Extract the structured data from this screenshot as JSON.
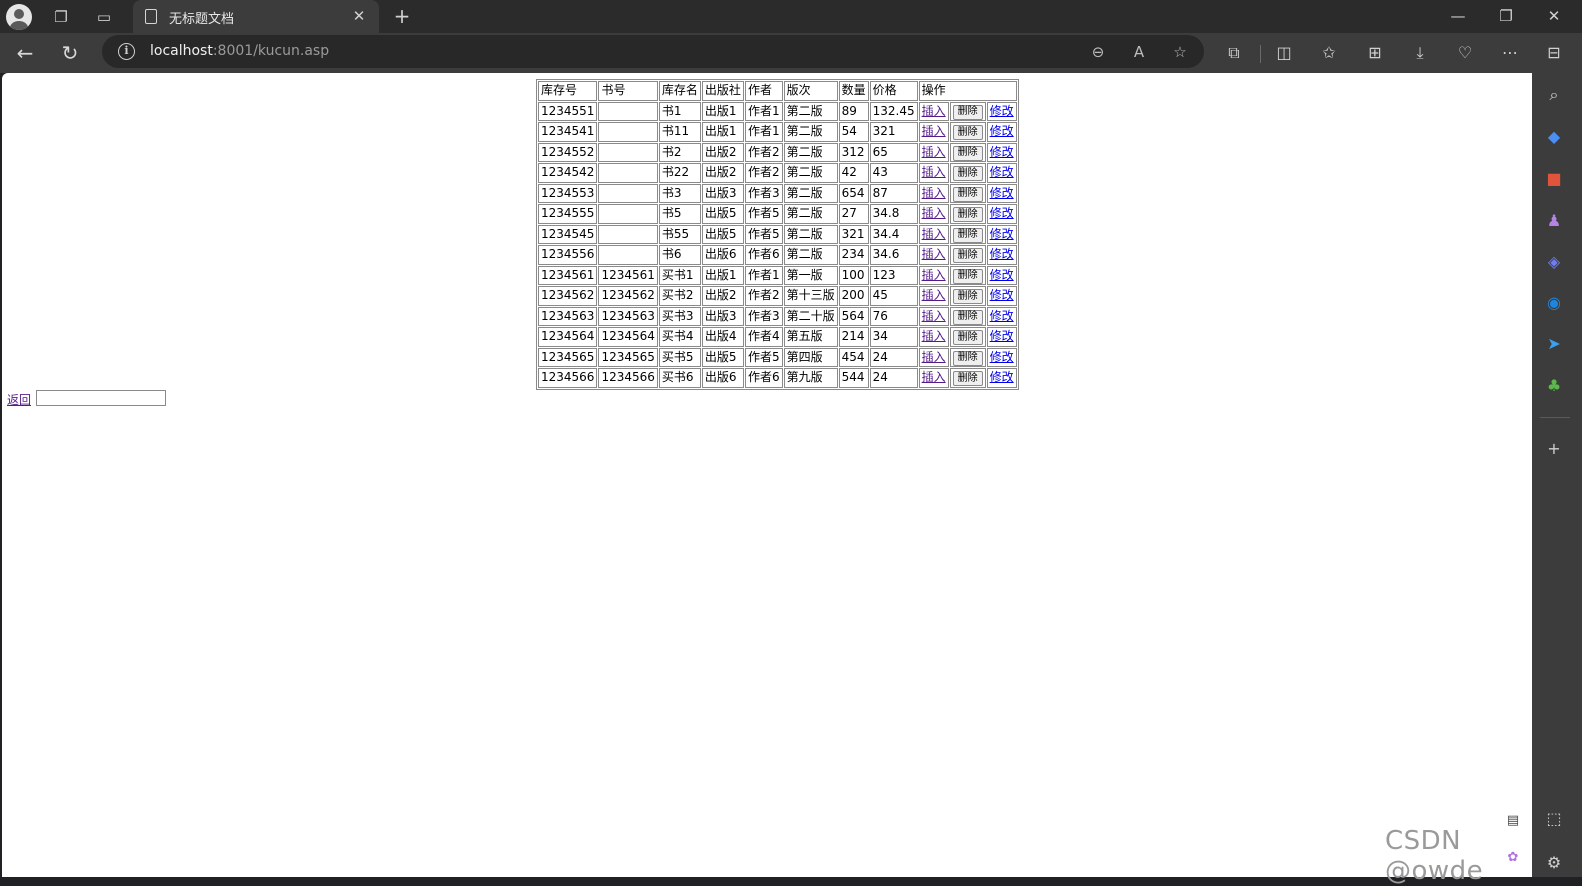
{
  "browser": {
    "tab_title": "无标题文档",
    "url_host": "localhost",
    "url_rest": ":8001/kucun.asp"
  },
  "table": {
    "headers": [
      "库存号",
      "书号",
      "库存名",
      "出版社",
      "作者",
      "版次",
      "数量",
      "价格",
      "操作"
    ],
    "rows": [
      [
        "1234551",
        "",
        "书1",
        "出版1",
        "作者1",
        "第二版",
        "89",
        "132.45"
      ],
      [
        "1234541",
        "",
        "书11",
        "出版1",
        "作者1",
        "第二版",
        "54",
        "321"
      ],
      [
        "1234552",
        "",
        "书2",
        "出版2",
        "作者2",
        "第二版",
        "312",
        "65"
      ],
      [
        "1234542",
        "",
        "书22",
        "出版2",
        "作者2",
        "第二版",
        "42",
        "43"
      ],
      [
        "1234553",
        "",
        "书3",
        "出版3",
        "作者3",
        "第二版",
        "654",
        "87"
      ],
      [
        "1234555",
        "",
        "书5",
        "出版5",
        "作者5",
        "第二版",
        "27",
        "34.8"
      ],
      [
        "1234545",
        "",
        "书55",
        "出版5",
        "作者5",
        "第二版",
        "321",
        "34.4"
      ],
      [
        "1234556",
        "",
        "书6",
        "出版6",
        "作者6",
        "第二版",
        "234",
        "34.6"
      ],
      [
        "1234561",
        "1234561",
        "买书1",
        "出版1",
        "作者1",
        "第一版",
        "100",
        "123"
      ],
      [
        "1234562",
        "1234562",
        "买书2",
        "出版2",
        "作者2",
        "第十三版",
        "200",
        "45"
      ],
      [
        "1234563",
        "1234563",
        "买书3",
        "出版3",
        "作者3",
        "第二十版",
        "564",
        "76"
      ],
      [
        "1234564",
        "1234564",
        "买书4",
        "出版4",
        "作者4",
        "第五版",
        "214",
        "34"
      ],
      [
        "1234565",
        "1234565",
        "买书5",
        "出版5",
        "作者5",
        "第四版",
        "454",
        "24"
      ],
      [
        "1234566",
        "1234566",
        "买书6",
        "出版6",
        "作者6",
        "第九版",
        "544",
        "24"
      ]
    ],
    "insert_label": "插入",
    "delete_label": "删除",
    "edit_label": "修改"
  },
  "footer": {
    "back_label": "返回",
    "input_value": ""
  },
  "watermark": "CSDN @owde",
  "icons": {
    "titlebar": [
      "profile-avatar-icon",
      "workspaces-icon",
      "tab-actions-icon"
    ],
    "toolbar": [
      "back-arrow-icon",
      "refresh-icon",
      "info-icon",
      "zoom-icon",
      "read-aloud-icon",
      "favorite-star-icon",
      "extensions-icon",
      "split-screen-icon",
      "favorites-icon",
      "collections-icon",
      "downloads-icon",
      "browser-essentials-icon",
      "more-icon",
      "sidebar-toggle-icon"
    ],
    "sidebar": [
      "search-icon",
      "shopping-tag-icon",
      "tools-icon",
      "games-icon",
      "copilot-icon",
      "outlook-icon",
      "send-icon",
      "tree-icon",
      "add-icon"
    ]
  }
}
